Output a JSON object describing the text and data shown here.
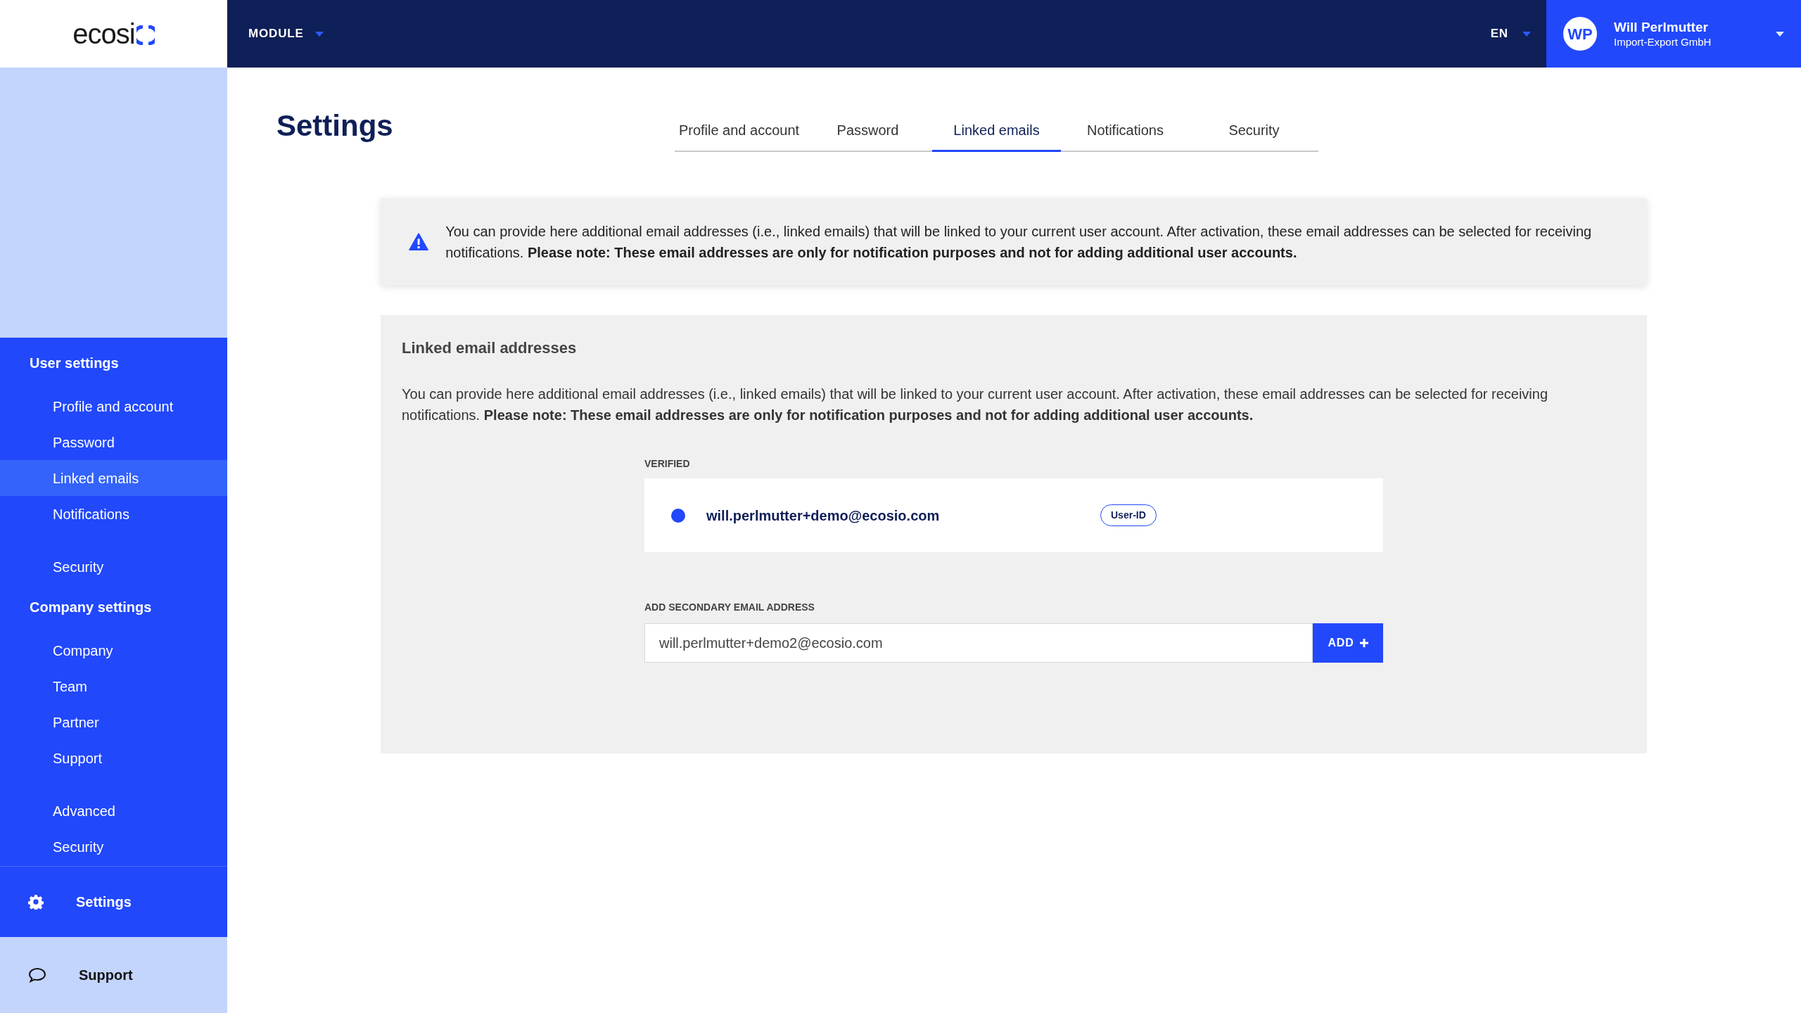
{
  "header": {
    "logo": "ecosi",
    "module": "MODULE",
    "language": "EN",
    "user": {
      "initials": "WP",
      "name": "Will Perlmutter",
      "company": "Import-Export GmbH"
    }
  },
  "sidebar": {
    "groups": [
      {
        "title": "User settings",
        "items": [
          {
            "label": "Profile and account",
            "selected": false
          },
          {
            "label": "Password",
            "selected": false
          },
          {
            "label": "Linked emails",
            "selected": true
          },
          {
            "label": "Notifications",
            "selected": false
          },
          {
            "label": "Security",
            "selected": false,
            "gap": true
          }
        ]
      },
      {
        "title": "Company settings",
        "items": [
          {
            "label": "Company",
            "selected": false
          },
          {
            "label": "Team",
            "selected": false
          },
          {
            "label": "Partner",
            "selected": false
          },
          {
            "label": "Support",
            "selected": false
          },
          {
            "label": "Advanced",
            "selected": false,
            "gap": true
          },
          {
            "label": "Security",
            "selected": false
          }
        ]
      }
    ],
    "bottom": [
      {
        "kind": "settings",
        "label": "Settings"
      },
      {
        "kind": "support",
        "label": "Support"
      }
    ]
  },
  "page": {
    "title": "Settings",
    "tabs": [
      {
        "label": "Profile and account",
        "selected": false
      },
      {
        "label": "Password",
        "selected": false
      },
      {
        "label": "Linked emails",
        "selected": true
      },
      {
        "label": "Notifications",
        "selected": false
      },
      {
        "label": "Security",
        "selected": false
      }
    ],
    "alert": "You can provide here additional email addresses (i.e., linked emails) that will be linked to your current user account. After activation, these email addresses can be selected for receiving notifications. **Please note: These email addresses are only for notification purposes and not for adding additional user accounts.**",
    "panel": {
      "title": "Linked email addresses",
      "description": "You can provide here additional email addresses (i.e., linked emails) that will be linked to your current user account. After activation, these email addresses can be selected for receiving notifications. **Please note: These email addresses are only for notification purposes and not for adding additional user accounts.**",
      "verified_label": "VERIFIED",
      "verified": [
        {
          "email": "will.perlmutter+demo@ecosio.com",
          "badge": "User-ID"
        }
      ],
      "add_label": "ADD SECONDARY EMAIL ADDRESS",
      "add_value": "will.perlmutter+demo2@ecosio.com",
      "add_button": "ADD"
    }
  }
}
